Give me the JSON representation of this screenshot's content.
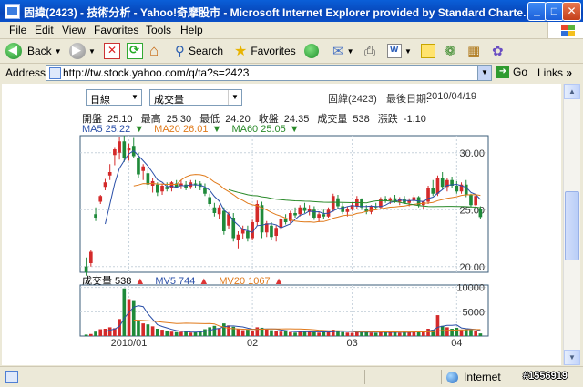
{
  "window": {
    "title": "固緯(2423) - 技術分析 - Yahoo!奇摩股市 - Microsoft Internet Explorer provided by Standard Charte...",
    "buttons": {
      "minimize": "_",
      "maximize": "□",
      "close": "✕"
    }
  },
  "menu": [
    "File",
    "Edit",
    "View",
    "Favorites",
    "Tools",
    "Help"
  ],
  "toolbar": {
    "back_label": "Back",
    "search_label": "Search",
    "favorites_label": "Favorites"
  },
  "address": {
    "label": "Address",
    "url": "http://tw.stock.yahoo.com/q/ta?s=2423",
    "go_label": "Go",
    "links_label": "Links"
  },
  "page": {
    "period_select": "日線",
    "indicator_select": "成交量",
    "stock_name": "固緯(2423)",
    "last_date_label": "最後日期:",
    "last_date": "2010/04/19",
    "stats": {
      "open_label": "開盤",
      "open": "25.10",
      "high_label": "最高",
      "high": "25.30",
      "low_label": "最低",
      "low": "24.20",
      "close_label": "收盤",
      "close": "24.35",
      "volume_label": "成交量",
      "volume": "538",
      "change_label": "漲跌",
      "change": "-1.10"
    },
    "ma": {
      "ma5": "MA5 25.22",
      "ma20": "MA20 26.01",
      "ma60": "MA60 25.05"
    },
    "vol": {
      "volume": "成交量 538",
      "mv5": "MV5 744",
      "mv20": "MV20 1067"
    }
  },
  "chart_data": {
    "type": "candlestick",
    "price_axis": {
      "ticks": [
        "30.00",
        "25.00",
        "20.00"
      ],
      "ylim": [
        19.5,
        31.5
      ]
    },
    "volume_axis": {
      "ticks": [
        "10000",
        "5000"
      ],
      "ylim": [
        0,
        10500
      ]
    },
    "x_ticks": [
      "2010/01",
      "02",
      "03",
      "04"
    ],
    "ohlc": [
      [
        20.0,
        20.8,
        19.2,
        19.5
      ],
      [
        20.3,
        21.5,
        20.0,
        21.3
      ],
      [
        24.6,
        25.2,
        24.0,
        24.3
      ],
      [
        25.7,
        26.3,
        25.5,
        26.2
      ],
      [
        27.0,
        27.7,
        26.7,
        27.4
      ],
      [
        28.0,
        29.0,
        27.6,
        28.3
      ],
      [
        29.8,
        30.5,
        28.9,
        30.3
      ],
      [
        30.0,
        31.4,
        29.4,
        31.0
      ],
      [
        31.0,
        31.5,
        29.2,
        29.5
      ],
      [
        30.2,
        30.8,
        29.3,
        30.4
      ],
      [
        30.6,
        31.3,
        29.5,
        29.7
      ],
      [
        29.5,
        30.0,
        27.8,
        28.1
      ],
      [
        28.4,
        29.0,
        27.6,
        28.8
      ],
      [
        28.2,
        28.7,
        26.8,
        27.2
      ],
      [
        27.1,
        27.8,
        26.5,
        27.5
      ],
      [
        27.2,
        27.4,
        26.2,
        26.5
      ],
      [
        26.6,
        27.3,
        26.3,
        27.1
      ],
      [
        27.0,
        27.4,
        26.6,
        26.8
      ],
      [
        26.9,
        27.5,
        26.6,
        27.4
      ],
      [
        27.3,
        27.6,
        26.9,
        27.0
      ],
      [
        27.1,
        27.6,
        26.8,
        27.3
      ],
      [
        27.2,
        27.5,
        26.7,
        26.9
      ],
      [
        27.0,
        27.6,
        26.8,
        27.4
      ],
      [
        27.3,
        27.6,
        26.9,
        27.2
      ],
      [
        27.3,
        27.5,
        26.7,
        27.0
      ],
      [
        26.9,
        27.3,
        26.2,
        26.4
      ],
      [
        26.1,
        26.4,
        25.3,
        25.5
      ],
      [
        25.2,
        25.6,
        24.4,
        24.7
      ],
      [
        24.6,
        25.4,
        24.2,
        25.2
      ],
      [
        24.9,
        25.2,
        22.8,
        23.1
      ],
      [
        23.6,
        24.8,
        23.3,
        24.6
      ],
      [
        24.3,
        24.7,
        22.2,
        22.5
      ],
      [
        22.3,
        23.1,
        21.6,
        22.8
      ],
      [
        22.9,
        23.6,
        22.4,
        23.3
      ],
      [
        23.1,
        23.6,
        22.2,
        22.5
      ],
      [
        22.5,
        24.1,
        22.3,
        23.9
      ],
      [
        23.9,
        25.8,
        23.6,
        25.5
      ],
      [
        25.4,
        25.7,
        22.5,
        23.0
      ],
      [
        23.0,
        24.0,
        22.6,
        23.8
      ],
      [
        23.6,
        23.9,
        22.3,
        22.6
      ],
      [
        22.7,
        23.6,
        22.2,
        23.4
      ],
      [
        23.4,
        24.4,
        23.2,
        24.2
      ],
      [
        24.2,
        24.6,
        23.7,
        23.9
      ],
      [
        24.0,
        24.9,
        23.8,
        24.7
      ],
      [
        24.7,
        25.2,
        24.3,
        24.5
      ],
      [
        24.6,
        25.4,
        24.4,
        25.2
      ],
      [
        25.2,
        25.6,
        24.7,
        24.9
      ],
      [
        24.8,
        25.4,
        24.5,
        25.1
      ],
      [
        25.0,
        25.3,
        24.1,
        24.3
      ],
      [
        24.3,
        24.8,
        23.9,
        24.6
      ],
      [
        24.6,
        25.0,
        24.2,
        24.4
      ],
      [
        24.4,
        25.2,
        24.3,
        25.0
      ],
      [
        25.0,
        26.4,
        24.8,
        26.2
      ],
      [
        26.0,
        26.3,
        25.1,
        25.3
      ],
      [
        25.3,
        25.6,
        24.6,
        24.8
      ],
      [
        24.8,
        25.3,
        24.4,
        25.1
      ],
      [
        25.1,
        25.6,
        24.9,
        25.4
      ],
      [
        25.3,
        26.2,
        25.1,
        25.9
      ],
      [
        25.9,
        26.0,
        25.0,
        25.2
      ],
      [
        25.1,
        25.4,
        24.6,
        24.8
      ],
      [
        24.8,
        25.4,
        24.6,
        25.3
      ],
      [
        25.3,
        25.6,
        25.0,
        25.2
      ],
      [
        25.2,
        26.1,
        25.1,
        25.9
      ],
      [
        25.9,
        26.2,
        25.6,
        25.8
      ],
      [
        25.8,
        26.1,
        25.5,
        26.0
      ],
      [
        26.0,
        26.3,
        25.6,
        25.7
      ],
      [
        25.7,
        26.1,
        25.4,
        25.9
      ],
      [
        25.9,
        26.2,
        25.5,
        25.6
      ],
      [
        25.6,
        26.0,
        25.3,
        25.8
      ],
      [
        25.8,
        26.3,
        25.6,
        26.1
      ],
      [
        26.1,
        26.2,
        25.2,
        25.4
      ],
      [
        25.4,
        25.8,
        25.1,
        25.7
      ],
      [
        25.7,
        27.1,
        25.5,
        26.9
      ],
      [
        26.9,
        27.6,
        26.2,
        26.4
      ],
      [
        26.4,
        28.0,
        26.2,
        27.8
      ],
      [
        27.8,
        28.3,
        26.8,
        27.0
      ],
      [
        27.0,
        27.8,
        26.6,
        27.6
      ],
      [
        27.6,
        27.9,
        26.9,
        27.1
      ],
      [
        27.1,
        27.5,
        26.4,
        26.6
      ],
      [
        26.6,
        27.4,
        26.4,
        27.2
      ],
      [
        27.2,
        27.6,
        26.1,
        26.3
      ],
      [
        26.3,
        26.4,
        25.2,
        25.4
      ],
      [
        25.4,
        26.4,
        25.3,
        26.2
      ],
      [
        25.1,
        25.3,
        24.2,
        24.35
      ]
    ],
    "volumes": [
      300,
      420,
      900,
      1400,
      1500,
      1800,
      1600,
      3500,
      9800,
      7600,
      7200,
      3100,
      2600,
      2400,
      2000,
      1500,
      1300,
      1100,
      900,
      800,
      850,
      900,
      700,
      800,
      1000,
      1400,
      1800,
      2100,
      1600,
      2600,
      2200,
      1900,
      1500,
      1200,
      1300,
      1100,
      1800,
      1700,
      1400,
      1200,
      1000,
      900,
      1100,
      800,
      700,
      900,
      1000,
      950,
      800,
      700,
      750,
      900,
      1300,
      1100,
      800,
      700,
      650,
      900,
      1000,
      750,
      700,
      650,
      900,
      800,
      700,
      750,
      650,
      900,
      800,
      1000,
      1100,
      900,
      1500,
      1300,
      4300,
      2100,
      1800,
      1500,
      1700,
      1200,
      1400,
      1300,
      1100,
      538
    ]
  }
}
